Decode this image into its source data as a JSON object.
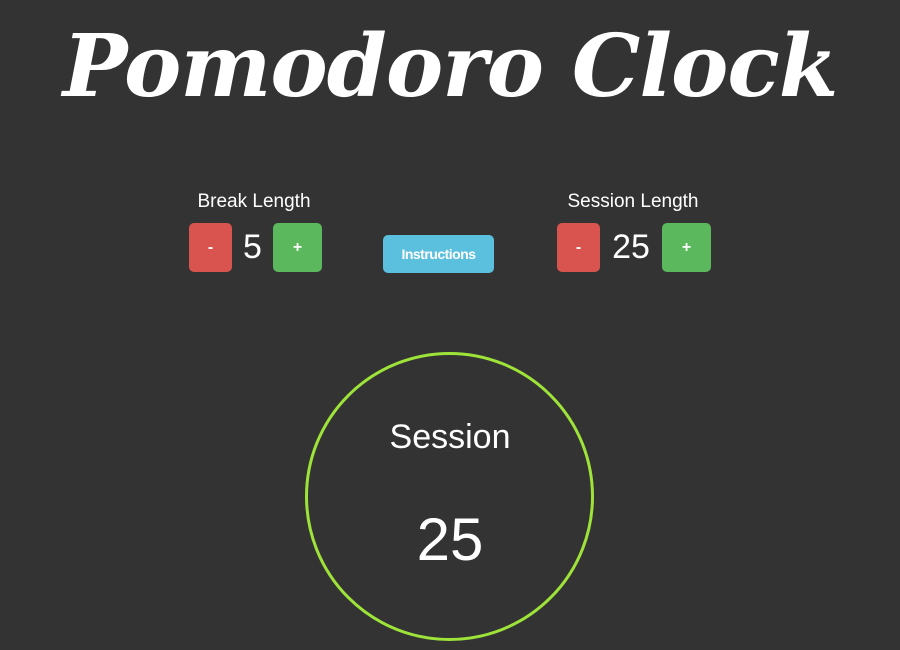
{
  "title": "Pomodoro Clock",
  "break": {
    "label": "Break Length",
    "decrement_label": "-",
    "value": "5",
    "increment_label": "+"
  },
  "instructions": {
    "label": "Instructions"
  },
  "session": {
    "label": "Session Length",
    "decrement_label": "-",
    "value": "25",
    "increment_label": "+"
  },
  "timer": {
    "mode": "Session",
    "time": "25",
    "ring_color": "#9ee339"
  },
  "colors": {
    "background": "#333333",
    "decrement": "#d9534f",
    "increment": "#5cb85c",
    "info": "#5bc0de"
  }
}
